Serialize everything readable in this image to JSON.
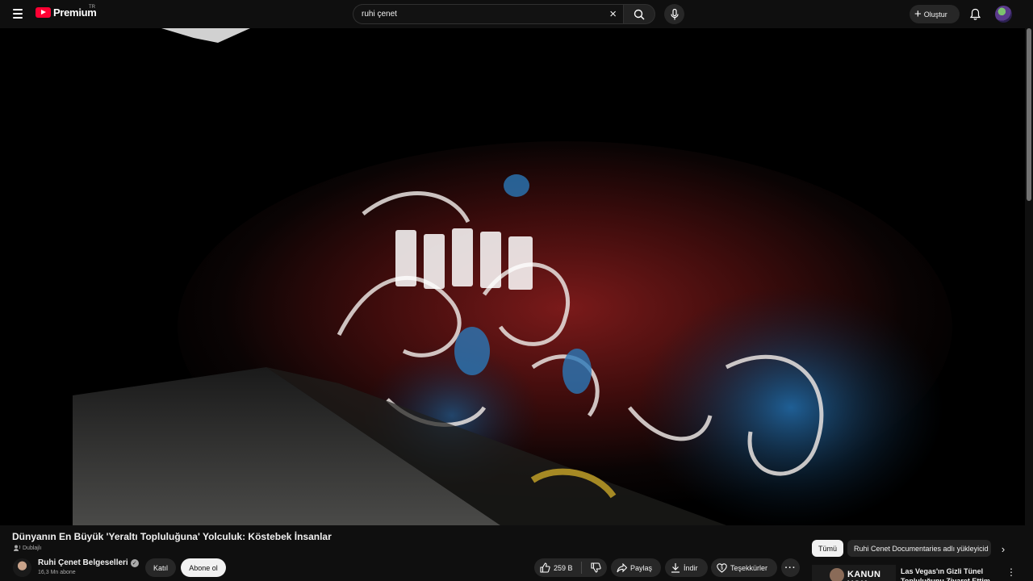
{
  "header": {
    "logo_text": "Premium",
    "logo_country": "TR",
    "search": {
      "value": "ruhi çenet"
    },
    "create_label": "Oluştur"
  },
  "video": {
    "title": "Dünyanın En Büyük 'Yeraltı Topluluğuna' Yolculuk: Köstebek İnsanlar",
    "dubbed_label": "Dublajlı"
  },
  "channel": {
    "name": "Ruhi Çenet Belgeselleri",
    "subscribers": "16,3 Mn abone",
    "join_label": "Katıl",
    "subscribe_label": "Abone ol"
  },
  "actions": {
    "like_count": "259 B",
    "share_label": "Paylaş",
    "download_label": "İndir",
    "thanks_label": "Teşekkürler"
  },
  "sidebar": {
    "chips": [
      {
        "label": "Tümü",
        "selected": true
      },
      {
        "label": "Ruhi Cenet Documentaries adlı yükleyicid",
        "selected": false
      }
    ],
    "recommended": {
      "thumb_text": "KANUN YOK",
      "title": "Las Vegas'ın Gizli Tünel Topluluğunu Ziyaret Ettim"
    }
  },
  "colors": {
    "background": "#0f0f0f",
    "logo_red": "#ff0033",
    "chip_bg": "#272727",
    "subscribe_bg": "#f1f1f1"
  },
  "icons": {
    "menu": "hamburger-icon",
    "search": "search-icon",
    "clear": "close-icon",
    "mic": "microphone-icon",
    "create": "plus-icon",
    "notifications": "bell-icon",
    "like": "thumbs-up-icon",
    "dislike": "thumbs-down-icon",
    "share": "share-arrow-icon",
    "download": "download-icon",
    "thanks": "heart-dollar-icon",
    "more": "more-horizontal-icon"
  }
}
